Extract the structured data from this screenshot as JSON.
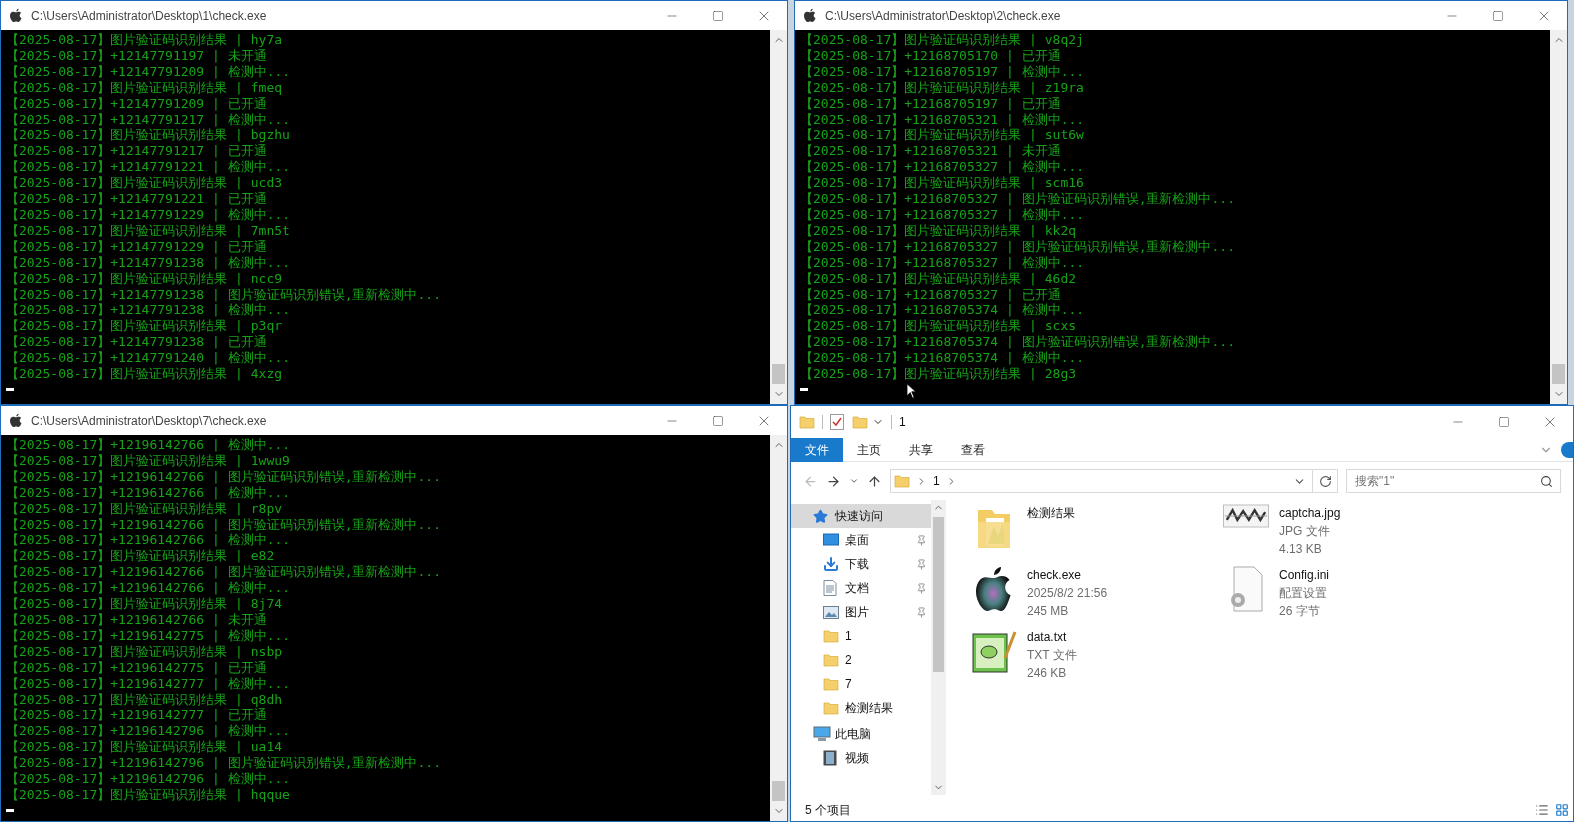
{
  "consoles": [
    {
      "title": "C:\\Users\\Administrator\\Desktop\\1\\check.exe",
      "mouse_pointer": false,
      "lines": [
        "【2025-08-17】图片验证码识别结果 | hy7a",
        "【2025-08-17】+12147791197 | 未开通",
        "【2025-08-17】+12147791209 | 检测中...",
        "【2025-08-17】图片验证码识别结果 | fmeq",
        "【2025-08-17】+12147791209 | 已开通",
        "【2025-08-17】+12147791217 | 检测中...",
        "【2025-08-17】图片验证码识别结果 | bgzhu",
        "【2025-08-17】+12147791217 | 已开通",
        "【2025-08-17】+12147791221 | 检测中...",
        "【2025-08-17】图片验证码识别结果 | ucd3",
        "【2025-08-17】+12147791221 | 已开通",
        "【2025-08-17】+12147791229 | 检测中...",
        "【2025-08-17】图片验证码识别结果 | 7mn5t",
        "【2025-08-17】+12147791229 | 已开通",
        "【2025-08-17】+12147791238 | 检测中...",
        "【2025-08-17】图片验证码识别结果 | ncc9",
        "【2025-08-17】+12147791238 | 图片验证码识别错误,重新检测中...",
        "【2025-08-17】+12147791238 | 检测中...",
        "【2025-08-17】图片验证码识别结果 | p3qr",
        "【2025-08-17】+12147791238 | 已开通",
        "【2025-08-17】+12147791240 | 检测中...",
        "【2025-08-17】图片验证码识别结果 | 4xzg"
      ]
    },
    {
      "title": "C:\\Users\\Administrator\\Desktop\\2\\check.exe",
      "mouse_pointer": true,
      "lines": [
        "【2025-08-17】图片验证码识别结果 | v8q2j",
        "【2025-08-17】+12168705170 | 已开通",
        "【2025-08-17】+12168705197 | 检测中...",
        "【2025-08-17】图片验证码识别结果 | z19ra",
        "【2025-08-17】+12168705197 | 已开通",
        "【2025-08-17】+12168705321 | 检测中...",
        "【2025-08-17】图片验证码识别结果 | sut6w",
        "【2025-08-17】+12168705321 | 未开通",
        "【2025-08-17】+12168705327 | 检测中...",
        "【2025-08-17】图片验证码识别结果 | scm16",
        "【2025-08-17】+12168705327 | 图片验证码识别错误,重新检测中...",
        "【2025-08-17】+12168705327 | 检测中...",
        "【2025-08-17】图片验证码识别结果 | kk2q",
        "【2025-08-17】+12168705327 | 图片验证码识别错误,重新检测中...",
        "【2025-08-17】+12168705327 | 检测中...",
        "【2025-08-17】图片验证码识别结果 | 46d2",
        "【2025-08-17】+12168705327 | 已开通",
        "【2025-08-17】+12168705374 | 检测中...",
        "【2025-08-17】图片验证码识别结果 | scxs",
        "【2025-08-17】+12168705374 | 图片验证码识别错误,重新检测中...",
        "【2025-08-17】+12168705374 | 检测中...",
        "【2025-08-17】图片验证码识别结果 | 28g3"
      ]
    },
    {
      "title": "C:\\Users\\Administrator\\Desktop\\7\\check.exe",
      "mouse_pointer": false,
      "lines": [
        "【2025-08-17】+12196142766 | 检测中...",
        "【2025-08-17】图片验证码识别结果 | 1wwu9",
        "【2025-08-17】+12196142766 | 图片验证码识别错误,重新检测中...",
        "【2025-08-17】+12196142766 | 检测中...",
        "【2025-08-17】图片验证码识别结果 | r8pv",
        "【2025-08-17】+12196142766 | 图片验证码识别错误,重新检测中...",
        "【2025-08-17】+12196142766 | 检测中...",
        "【2025-08-17】图片验证码识别结果 | e82",
        "【2025-08-17】+12196142766 | 图片验证码识别错误,重新检测中...",
        "【2025-08-17】+12196142766 | 检测中...",
        "【2025-08-17】图片验证码识别结果 | 8j74",
        "【2025-08-17】+12196142766 | 未开通",
        "【2025-08-17】+12196142775 | 检测中...",
        "【2025-08-17】图片验证码识别结果 | nsbp",
        "【2025-08-17】+12196142775 | 已开通",
        "【2025-08-17】+12196142777 | 检测中...",
        "【2025-08-17】图片验证码识别结果 | q8dh",
        "【2025-08-17】+12196142777 | 已开通",
        "【2025-08-17】+12196142796 | 检测中...",
        "【2025-08-17】图片验证码识别结果 | ua14",
        "【2025-08-17】+12196142796 | 图片验证码识别错误,重新检测中...",
        "【2025-08-17】+12196142796 | 检测中...",
        "【2025-08-17】图片验证码识别结果 | hqque"
      ]
    }
  ],
  "explorer": {
    "title": "1",
    "tabs": [
      {
        "label": "文件",
        "selected": true
      },
      {
        "label": "主页",
        "selected": false
      },
      {
        "label": "共享",
        "selected": false
      },
      {
        "label": "查看",
        "selected": false
      }
    ],
    "address": {
      "path": "1"
    },
    "search": {
      "placeholder": "搜索\"1\""
    },
    "nav": [
      {
        "label": "快速访问",
        "kind": "quick",
        "selected": true,
        "children": [
          {
            "label": "桌面",
            "kind": "desktop",
            "pinned": true,
            "selected": false
          },
          {
            "label": "下载",
            "kind": "download",
            "pinned": true,
            "selected": false
          },
          {
            "label": "文档",
            "kind": "document",
            "pinned": true,
            "selected": false
          },
          {
            "label": "图片",
            "kind": "pictures",
            "pinned": true,
            "selected": false
          },
          {
            "label": "1",
            "kind": "folder",
            "pinned": false,
            "selected": false
          },
          {
            "label": "2",
            "kind": "folder",
            "pinned": false,
            "selected": false
          },
          {
            "label": "7",
            "kind": "folder",
            "pinned": false,
            "selected": false
          },
          {
            "label": "检测结果",
            "kind": "folder",
            "pinned": false,
            "selected": false
          }
        ]
      },
      {
        "label": "此电脑",
        "kind": "pc",
        "selected": false,
        "children": [
          {
            "label": "视频",
            "kind": "video",
            "pinned": false,
            "selected": false
          }
        ]
      }
    ],
    "files": [
      {
        "name": "检测结果",
        "kind": "folder"
      },
      {
        "name": "captcha.jpg",
        "kind": "captcha",
        "details": [
          "JPG 文件",
          "4.13 KB"
        ]
      },
      {
        "name": "check.exe",
        "kind": "apple",
        "details": [
          "2025/8/2 21:56",
          "245 MB"
        ]
      },
      {
        "name": "Config.ini",
        "kind": "config",
        "details": [
          "配置设置",
          "26 字节"
        ]
      },
      {
        "name": "data.txt",
        "kind": "notepad",
        "details": [
          "TXT 文件",
          "246 KB"
        ]
      }
    ],
    "status": "5 个项目"
  }
}
